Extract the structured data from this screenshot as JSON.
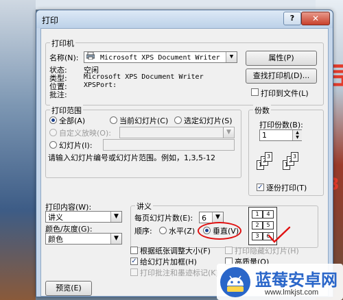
{
  "window": {
    "title": "打印",
    "help": "?",
    "close": "✕"
  },
  "printer": {
    "group": "打印机",
    "name_label": "名称(N):",
    "name_value": "Microsoft XPS Document Writer",
    "properties": "属性(P)",
    "find_printer": "查找打印机(D)...",
    "status_label": "状态:",
    "status_value": "空闲",
    "type_label": "类型:",
    "type_value": "Microsoft XPS Document Writer",
    "location_label": "位置:",
    "location_value": "XPSPort:",
    "comment_label": "批注:",
    "print_to_file": "打印到文件(L)"
  },
  "range": {
    "group": "打印范围",
    "all": "全部(A)",
    "current": "当前幻灯片(C)",
    "selection": "选定幻灯片(S)",
    "custom": "自定义放映(O):",
    "slides": "幻灯片(I):",
    "hint": "请输入幻灯片编号或幻灯片范围。例如，1,3,5-12"
  },
  "copies": {
    "group": "份数",
    "count_label": "打印份数(B):",
    "count_value": "1",
    "collate": "逐份打印(T)"
  },
  "content": {
    "what_label": "打印内容(W):",
    "what_value": "讲义",
    "color_label": "颜色/灰度(G):",
    "color_value": "颜色"
  },
  "handouts": {
    "group": "讲义",
    "per_page_label": "每页幻灯片数(E):",
    "per_page_value": "6",
    "order_label": "顺序:",
    "horizontal": "水平(Z)",
    "vertical": "垂直(V)"
  },
  "options": {
    "scale_to_fit": "根据纸张调整大小(F)",
    "frame_slides": "给幻灯片加框(H)",
    "print_comments": "打印批注和墨迹标记(K)",
    "print_hidden": "打印隐藏幻灯片(H)",
    "high_quality": "高质量(Q)"
  },
  "buttons": {
    "preview": "预览(E)"
  },
  "preview_numbers": [
    "1",
    "4",
    "2",
    "5",
    "3",
    "6"
  ],
  "collate_numbers": [
    "1",
    "2",
    "3",
    "1",
    "2",
    "3"
  ],
  "bg_text": {
    "right_char": "司",
    "bottom_right": "心",
    "mark": "3"
  },
  "watermark": {
    "brand": "蓝莓安卓网",
    "url": "www.lmkjst.com"
  },
  "colors": {
    "accent_blue": "#1a3f8a",
    "annotation_red": "#e01010",
    "brand_blue": "#2a66c9"
  }
}
